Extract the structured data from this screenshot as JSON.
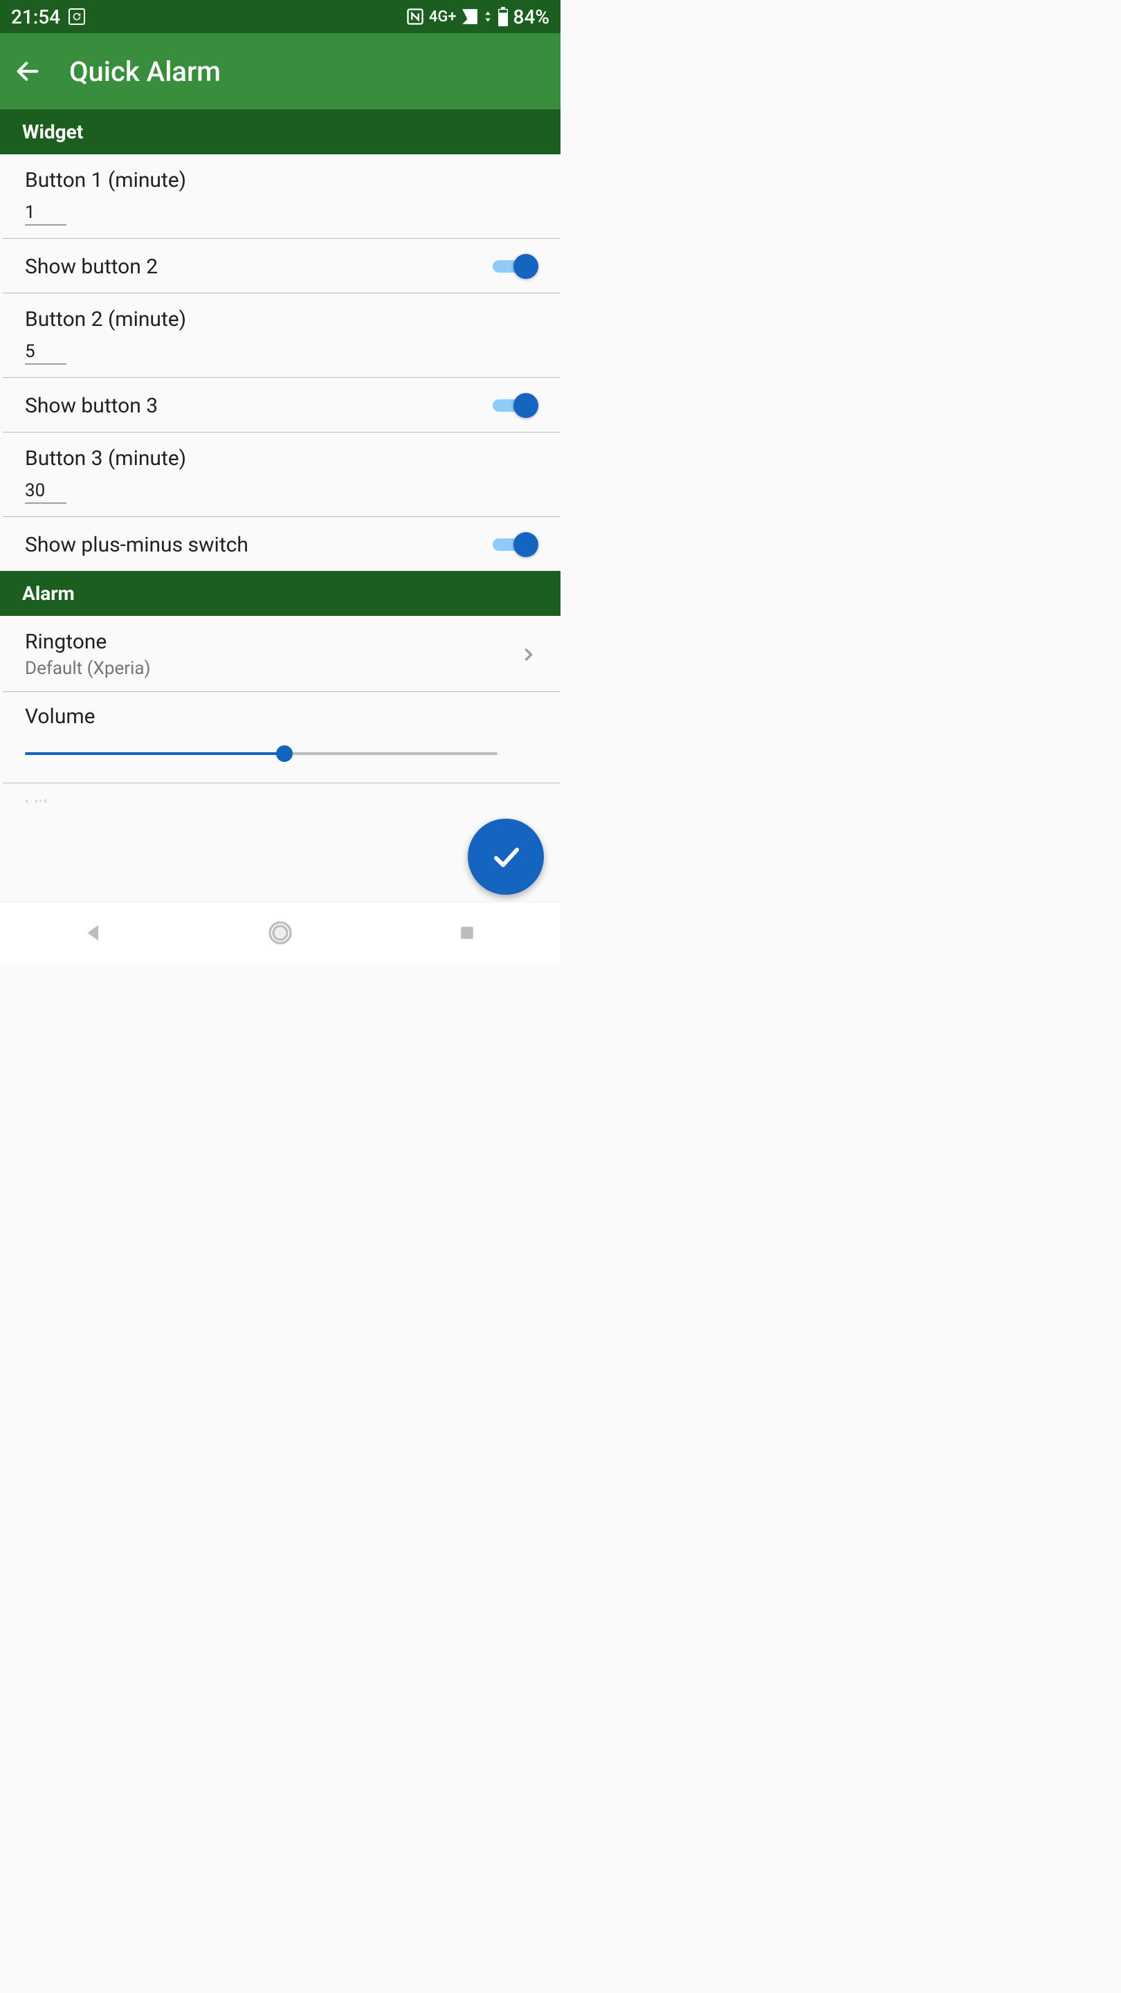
{
  "status": {
    "time": "21:54",
    "network_label": "4G+",
    "battery_pct": "84%"
  },
  "header": {
    "title": "Quick Alarm"
  },
  "sections": {
    "widget": {
      "label": "Widget",
      "button1_label": "Button 1 (minute)",
      "button1_value": "1",
      "show_button2_label": "Show button 2",
      "show_button2_on": true,
      "button2_label": "Button 2 (minute)",
      "button2_value": "5",
      "show_button3_label": "Show button 3",
      "show_button3_on": true,
      "button3_label": "Button 3 (minute)",
      "button3_value": "30",
      "show_plusminus_label": "Show plus-minus switch",
      "show_plusminus_on": true
    },
    "alarm": {
      "label": "Alarm",
      "ringtone_label": "Ringtone",
      "ringtone_value": "Default (Xperia)",
      "volume_label": "Volume",
      "volume_pct": 55,
      "next_label": "Vibrate"
    }
  }
}
